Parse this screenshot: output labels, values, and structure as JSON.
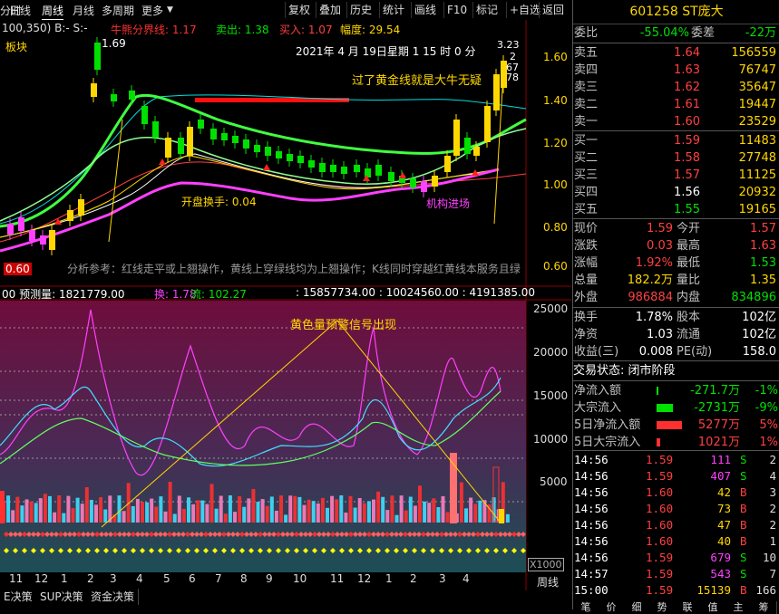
{
  "toolbar": {
    "tabs": [
      "分时",
      "日线",
      "周线",
      "月线",
      "多周期",
      "更多"
    ],
    "buttons": [
      "复权",
      "叠加",
      "历史",
      "统计",
      "画线",
      "F10",
      "标记",
      "+自选",
      "返回"
    ]
  },
  "stock": {
    "code": "601258",
    "name": "ST庞大"
  },
  "ratio": {
    "label": "委比",
    "value": "-55.04%",
    "label2": "委差",
    "value2": "-22万"
  },
  "sell_book": [
    {
      "label": "卖五",
      "price": "1.64",
      "vol": "156559"
    },
    {
      "label": "卖四",
      "price": "1.63",
      "vol": "76747"
    },
    {
      "label": "卖三",
      "price": "1.62",
      "vol": "35647"
    },
    {
      "label": "卖二",
      "price": "1.61",
      "vol": "19447"
    },
    {
      "label": "卖一",
      "price": "1.60",
      "vol": "23529"
    }
  ],
  "buy_book": [
    {
      "label": "买一",
      "price": "1.59",
      "vol": "11483"
    },
    {
      "label": "买二",
      "price": "1.58",
      "vol": "27748"
    },
    {
      "label": "买三",
      "price": "1.57",
      "vol": "11125"
    },
    {
      "label": "买四",
      "price": "1.56",
      "vol": "20932"
    },
    {
      "label": "买五",
      "price": "1.55",
      "vol": "19165"
    }
  ],
  "quote": [
    {
      "l1": "现价",
      "v1": "1.59",
      "l2": "今开",
      "v2": "1.57"
    },
    {
      "l1": "涨跌",
      "v1": "0.03",
      "l2": "最高",
      "v2": "1.63"
    },
    {
      "l1": "涨幅",
      "v1": "1.92%",
      "l2": "最低",
      "v2": "1.53"
    },
    {
      "l1": "总量",
      "v1": "182.2万",
      "l2": "量比",
      "v2": "1.35"
    },
    {
      "l1": "外盘",
      "v1": "986884",
      "l2": "内盘",
      "v2": "834896"
    }
  ],
  "fundamentals": [
    {
      "l1": "换手",
      "v1": "1.78%",
      "l2": "股本",
      "v2": "102亿"
    },
    {
      "l1": "净资",
      "v1": "1.03",
      "l2": "流通",
      "v2": "102亿"
    },
    {
      "l1": "收益(三)",
      "v1": "0.008",
      "l2": "PE(动)",
      "v2": "158.0"
    }
  ],
  "trade_state": "交易状态: 闭市阶段",
  "flows": [
    {
      "label": "净流入额",
      "value": "-271.7万",
      "pct": "-1%"
    },
    {
      "label": "大宗流入",
      "value": "-2731万",
      "pct": "-9%"
    },
    {
      "label": "5日净流入额",
      "value": "5277万",
      "pct": "5%"
    },
    {
      "label": "5日大宗流入",
      "value": "1021万",
      "pct": "1%"
    }
  ],
  "ticks": [
    {
      "t": "14:56",
      "p": "1.59",
      "v": "111",
      "d": "S",
      "n": "2"
    },
    {
      "t": "14:56",
      "p": "1.59",
      "v": "407",
      "d": "S",
      "n": "4"
    },
    {
      "t": "14:56",
      "p": "1.60",
      "v": "42",
      "d": "B",
      "n": "3"
    },
    {
      "t": "14:56",
      "p": "1.60",
      "v": "73",
      "d": "B",
      "n": "2"
    },
    {
      "t": "14:56",
      "p": "1.60",
      "v": "47",
      "d": "B",
      "n": "2"
    },
    {
      "t": "14:56",
      "p": "1.60",
      "v": "40",
      "d": "B",
      "n": "1"
    },
    {
      "t": "14:56",
      "p": "1.59",
      "v": "679",
      "d": "S",
      "n": "10"
    },
    {
      "t": "14:57",
      "p": "1.59",
      "v": "543",
      "d": "S",
      "n": "7"
    },
    {
      "t": "15:00",
      "p": "1.59",
      "v": "15139",
      "d": "B",
      "n": "166"
    }
  ],
  "bottom_right_tabs": [
    "笔",
    "价",
    "细",
    "势",
    "联",
    "值",
    "主",
    "筹"
  ],
  "chart": {
    "indicator_header": "100,350)  B:-   S:-",
    "line_labels": [
      {
        "text": "牛熊分界线: 1.17",
        "color": "#ff3030"
      },
      {
        "text": "卖出: 1.38",
        "color": "#00e000"
      },
      {
        "text": "买入: 1.07",
        "color": "#ff4040"
      },
      {
        "text": "幅度: 29.54",
        "color": "#ffd700"
      }
    ],
    "sector_label": "板块",
    "date_label": "2021年 4 月 19日星期 1   15 时 0 分",
    "peak_label": "1.69",
    "price_axis": [
      "1.60",
      "1.40",
      "1.20",
      "1.00",
      "0.80",
      "0.60"
    ],
    "right_top_values": [
      "3.23",
      "2",
      "67",
      "78"
    ],
    "annotation_gold": "过了黄金线就是大牛无疑",
    "annotation_open": "开盘换手: 0.04",
    "annotation_inst": "机构进场",
    "low_label": "0.60",
    "analysis_text": "分析参考：红线走平或上翘操作，黄线上穿绿线均为上翘操作；K线同时穿越红黄线本服务且绿",
    "vol_header": {
      "a": "00  预测量: 1821779.00",
      "b": "换: 1.78",
      "c": "流: 102.27",
      "d": ": 15857734.00 : 10024560.00 : 4191385.00"
    },
    "vol_annotation": "黄色量预警信号出现",
    "vol_axis": [
      "25000",
      "20000",
      "15000",
      "10000",
      "5000"
    ],
    "unit_label": "X1000",
    "x_labels": [
      "11",
      "12",
      "1",
      "2",
      "3",
      "4",
      "5",
      "6",
      "7",
      "8",
      "9",
      "10",
      "11",
      "12",
      "1",
      "2",
      "3",
      "4"
    ],
    "period_label": "周线",
    "bottom_tabs": [
      "E决策",
      "SUP决策",
      "资金决策"
    ]
  },
  "colors": {
    "up": "#ff3030",
    "down": "#00e000",
    "ma_white": "#ffffff",
    "ma_yellow": "#ffd700",
    "ma_green": "#40ff40",
    "ma_magenta": "#ff40ff",
    "vol_bg_top": "#7a1040",
    "vol_bg_bottom": "#1a4a50"
  }
}
